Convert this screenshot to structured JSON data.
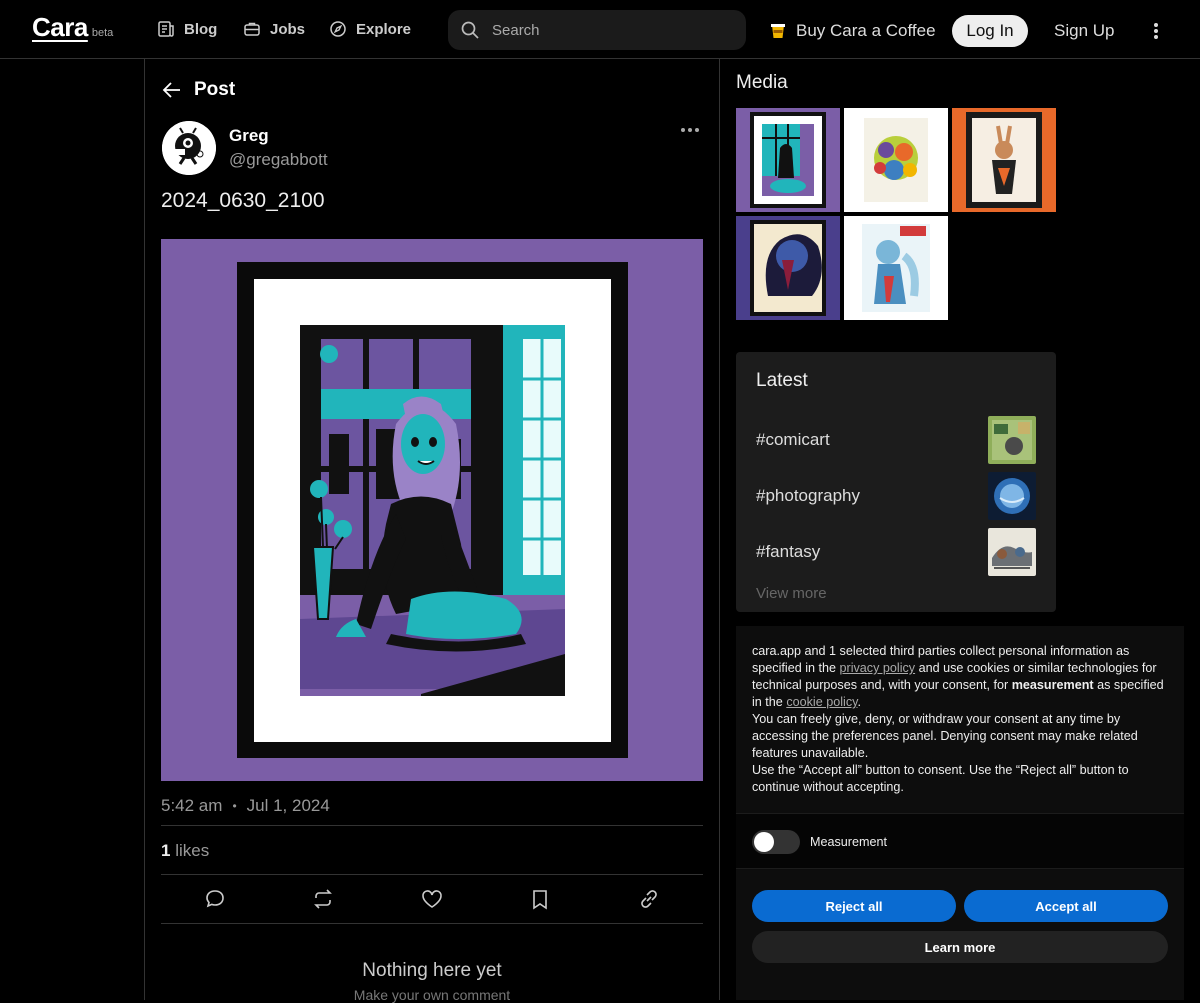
{
  "header": {
    "logo": "Cara",
    "logo_badge": "beta",
    "nav": [
      {
        "label": "Blog",
        "icon": "blog-icon"
      },
      {
        "label": "Jobs",
        "icon": "briefcase-icon"
      },
      {
        "label": "Explore",
        "icon": "compass-icon"
      }
    ],
    "search_placeholder": "Search",
    "coffee_label": "Buy Cara a Coffee",
    "login_label": "Log In",
    "signup_label": "Sign Up"
  },
  "post": {
    "back_label": "Post",
    "author_name": "Greg",
    "author_handle": "@gregabbott",
    "title": "2024_0630_2100",
    "time": "5:42 am",
    "date": "Jul 1, 2024",
    "likes_count": "1",
    "likes_label": "likes",
    "empty_title": "Nothing here yet",
    "empty_subtitle": "Make your own comment"
  },
  "sidebar": {
    "media_title": "Media",
    "latest_title": "Latest",
    "tags": [
      "#comicart",
      "#photography",
      "#fantasy"
    ],
    "view_more": "View more"
  },
  "consent": {
    "text_1": "cara.app and 1 selected third parties collect personal information as specified in the ",
    "privacy_link": "privacy policy",
    "text_2": " and use cookies or similar technologies for technical purposes and, with your consent, for ",
    "measurement_bold": "measurement",
    "text_3": " as specified in the ",
    "cookie_link": "cookie policy",
    "text_4": ".",
    "text_5": "You can freely give, deny, or withdraw your consent at any time by accessing the preferences panel. Denying consent may make related features unavailable.",
    "text_6": "Use the “Accept all” button to consent. Use the “Reject all” button to continue without accepting.",
    "toggle_label": "Measurement",
    "reject_label": "Reject all",
    "accept_label": "Accept all",
    "learn_label": "Learn more"
  },
  "colors": {
    "accent_blue": "#0a6bd1",
    "art_purple": "#7b5ea7",
    "art_teal": "#21b5bb",
    "orange": "#e8692a"
  }
}
